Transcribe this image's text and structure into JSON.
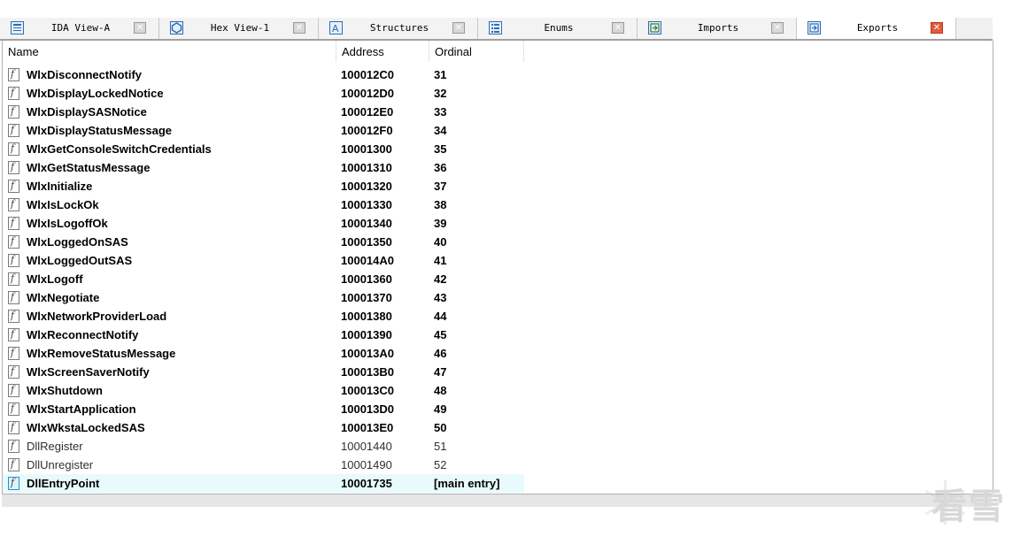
{
  "tabs": [
    {
      "label": "IDA View-A",
      "icon": "ida-view-icon",
      "active": false
    },
    {
      "label": "Hex View-1",
      "icon": "hex-view-icon",
      "active": false
    },
    {
      "label": "Structures",
      "icon": "structures-icon",
      "active": false
    },
    {
      "label": "Enums",
      "icon": "enums-icon",
      "active": false
    },
    {
      "label": "Imports",
      "icon": "imports-icon",
      "active": false
    },
    {
      "label": "Exports",
      "icon": "exports-icon",
      "active": true
    }
  ],
  "table": {
    "columns": {
      "name": "Name",
      "address": "Address",
      "ordinal": "Ordinal"
    },
    "rows": [
      {
        "name": "WlxDisconnectNotify",
        "address": "100012C0",
        "ordinal": "31",
        "style": "bold"
      },
      {
        "name": "WlxDisplayLockedNotice",
        "address": "100012D0",
        "ordinal": "32",
        "style": "bold"
      },
      {
        "name": "WlxDisplaySASNotice",
        "address": "100012E0",
        "ordinal": "33",
        "style": "bold"
      },
      {
        "name": "WlxDisplayStatusMessage",
        "address": "100012F0",
        "ordinal": "34",
        "style": "bold"
      },
      {
        "name": "WlxGetConsoleSwitchCredentials",
        "address": "10001300",
        "ordinal": "35",
        "style": "bold"
      },
      {
        "name": "WlxGetStatusMessage",
        "address": "10001310",
        "ordinal": "36",
        "style": "bold"
      },
      {
        "name": "WlxInitialize",
        "address": "10001320",
        "ordinal": "37",
        "style": "bold"
      },
      {
        "name": "WlxIsLockOk",
        "address": "10001330",
        "ordinal": "38",
        "style": "bold"
      },
      {
        "name": "WlxIsLogoffOk",
        "address": "10001340",
        "ordinal": "39",
        "style": "bold"
      },
      {
        "name": "WlxLoggedOnSAS",
        "address": "10001350",
        "ordinal": "40",
        "style": "bold"
      },
      {
        "name": "WlxLoggedOutSAS",
        "address": "100014A0",
        "ordinal": "41",
        "style": "bold"
      },
      {
        "name": "WlxLogoff",
        "address": "10001360",
        "ordinal": "42",
        "style": "bold"
      },
      {
        "name": "WlxNegotiate",
        "address": "10001370",
        "ordinal": "43",
        "style": "bold"
      },
      {
        "name": "WlxNetworkProviderLoad",
        "address": "10001380",
        "ordinal": "44",
        "style": "bold"
      },
      {
        "name": "WlxReconnectNotify",
        "address": "10001390",
        "ordinal": "45",
        "style": "bold"
      },
      {
        "name": "WlxRemoveStatusMessage",
        "address": "100013A0",
        "ordinal": "46",
        "style": "bold"
      },
      {
        "name": "WlxScreenSaverNotify",
        "address": "100013B0",
        "ordinal": "47",
        "style": "bold"
      },
      {
        "name": "WlxShutdown",
        "address": "100013C0",
        "ordinal": "48",
        "style": "bold"
      },
      {
        "name": "WlxStartApplication",
        "address": "100013D0",
        "ordinal": "49",
        "style": "bold"
      },
      {
        "name": "WlxWkstaLockedSAS",
        "address": "100013E0",
        "ordinal": "50",
        "style": "bold"
      },
      {
        "name": "DllRegister",
        "address": "10001440",
        "ordinal": "51",
        "style": "normal"
      },
      {
        "name": "DllUnregister",
        "address": "10001490",
        "ordinal": "52",
        "style": "normal"
      },
      {
        "name": "DllEntryPoint",
        "address": "10001735",
        "ordinal": "[main entry]",
        "style": "selected"
      }
    ]
  },
  "watermark": {
    "text": "看雪",
    "icon": "snowflake-icon"
  },
  "colors": {
    "selected_row": "#e8fafc",
    "active_close": "#e25a3a"
  }
}
